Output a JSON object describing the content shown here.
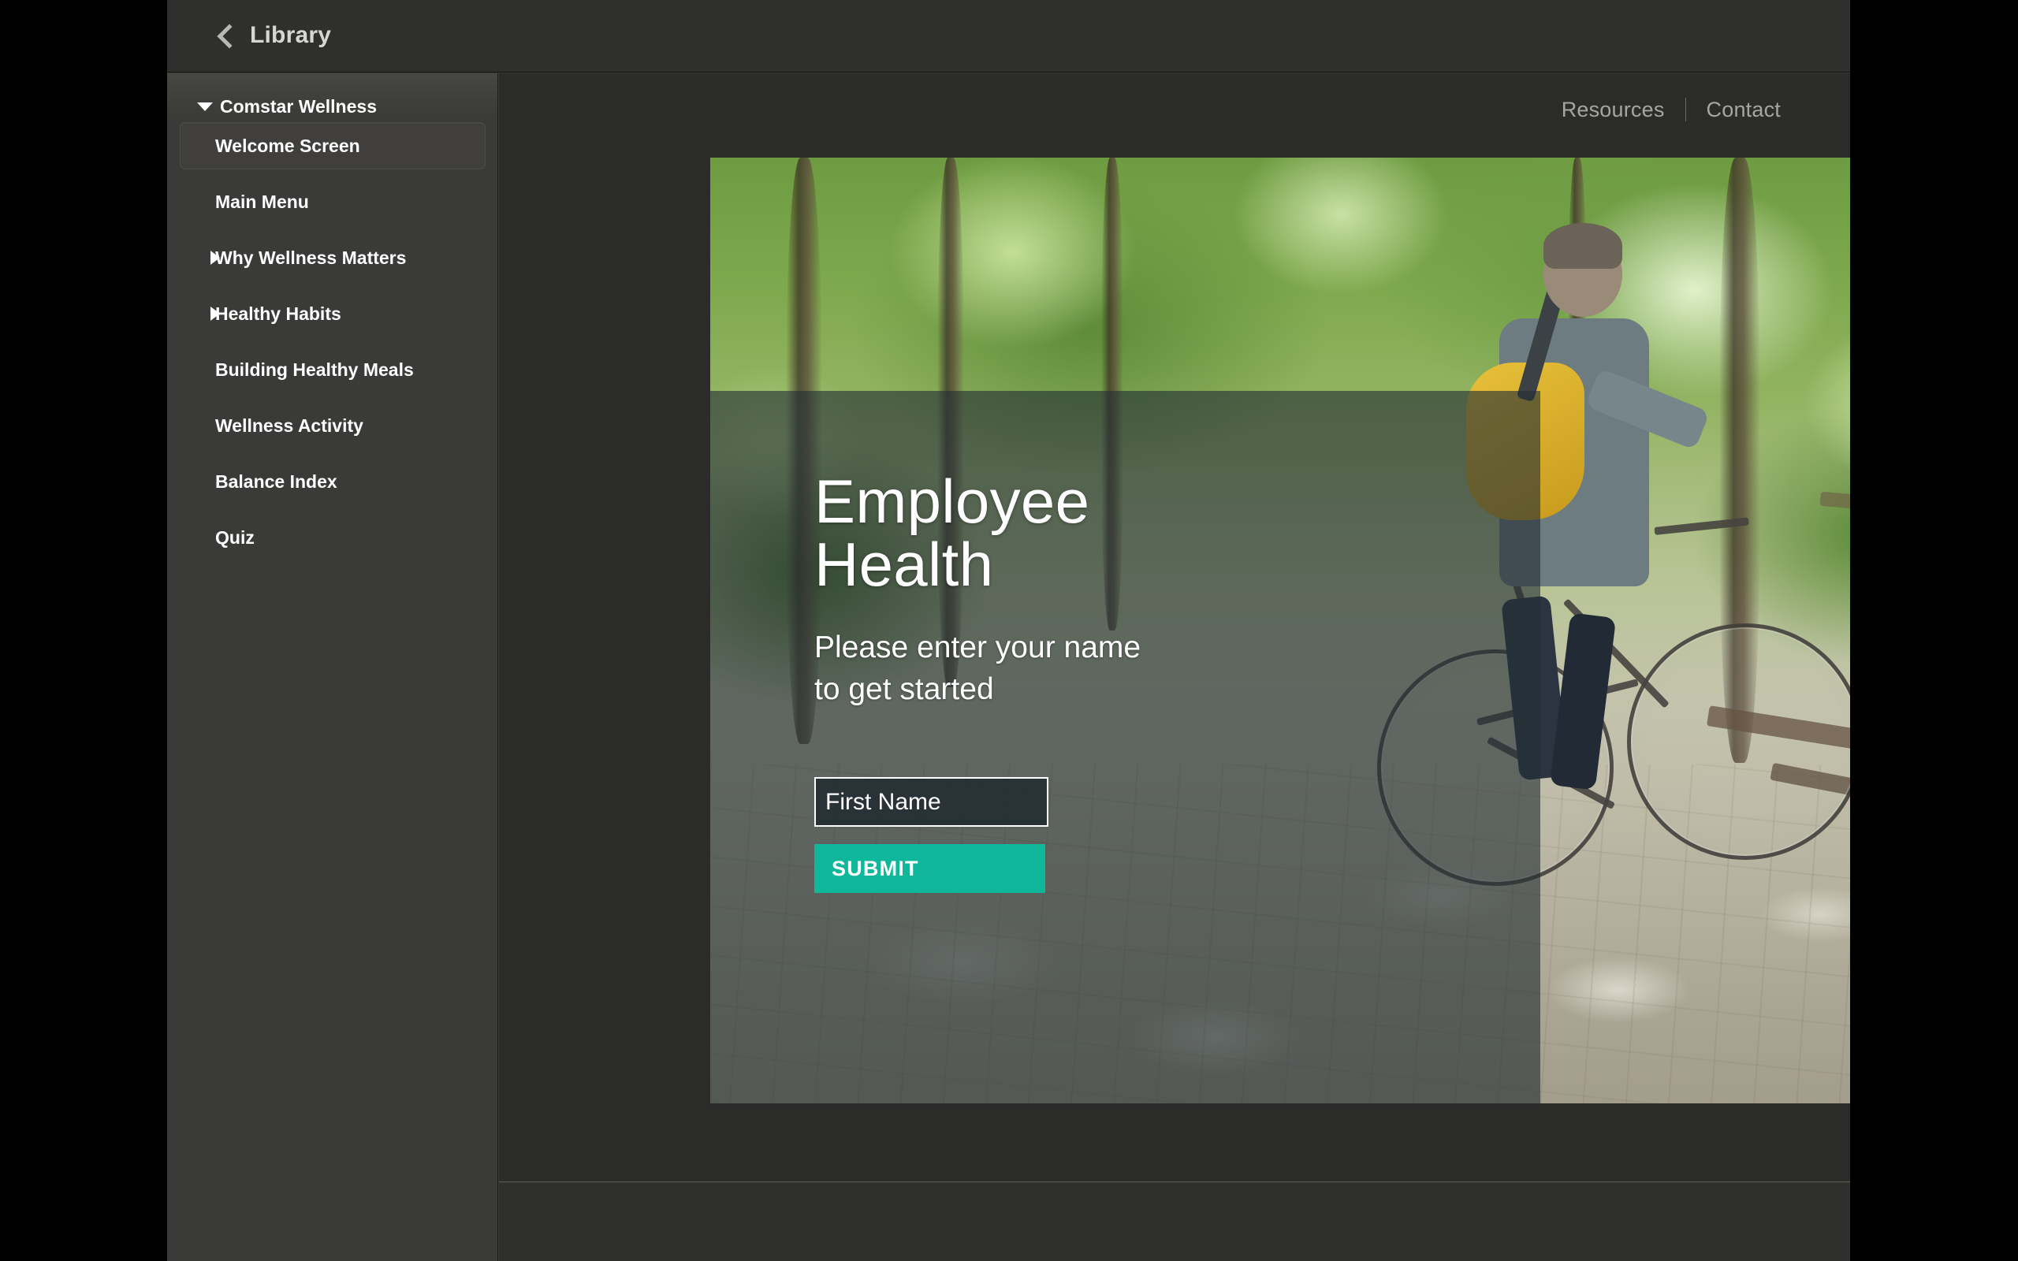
{
  "window": {
    "topbar": {
      "back_icon": "chevron-left-icon",
      "back_label": "Library"
    }
  },
  "sidebar": {
    "root": {
      "label": "Comstar Wellness",
      "expanded": true,
      "toggle_icon": "triangle-down-icon"
    },
    "items": [
      {
        "label": "Welcome Screen",
        "selected": true,
        "expandable": false
      },
      {
        "label": "Main Menu",
        "selected": false,
        "expandable": false
      },
      {
        "label": "Why Wellness Matters",
        "selected": false,
        "expandable": true,
        "toggle_icon": "triangle-right-icon"
      },
      {
        "label": "Healthy Habits",
        "selected": false,
        "expandable": true,
        "toggle_icon": "triangle-right-icon"
      },
      {
        "label": "Building Healthy Meals",
        "selected": false,
        "expandable": false
      },
      {
        "label": "Wellness Activity",
        "selected": false,
        "expandable": false
      },
      {
        "label": "Balance Index",
        "selected": false,
        "expandable": false
      },
      {
        "label": "Quiz",
        "selected": false,
        "expandable": false
      }
    ]
  },
  "course": {
    "nav": {
      "resources_label": "Resources",
      "contact_label": "Contact",
      "separator": "|"
    },
    "slide": {
      "title_line1": "Employee",
      "title_line2": "Health",
      "subtitle": "Please enter your name to get started",
      "form": {
        "first_name_value": "",
        "first_name_placeholder": "First Name",
        "submit_label": "SUBMIT"
      },
      "image_alt": "Man riding a bicycle with a yellow backpack on a tree-lined path"
    }
  },
  "colors": {
    "accent_teal": "#0fb89b",
    "window_bg": "#3a3a38",
    "content_bg": "#2b2b29",
    "topbar_bg": "#2f2f2d",
    "selected_item_bg": "#403f3d",
    "nav_link": "#a5a5a3",
    "text_primary": "#ffffff",
    "overlay_panel": "rgba(36,46,52,0.62)"
  }
}
